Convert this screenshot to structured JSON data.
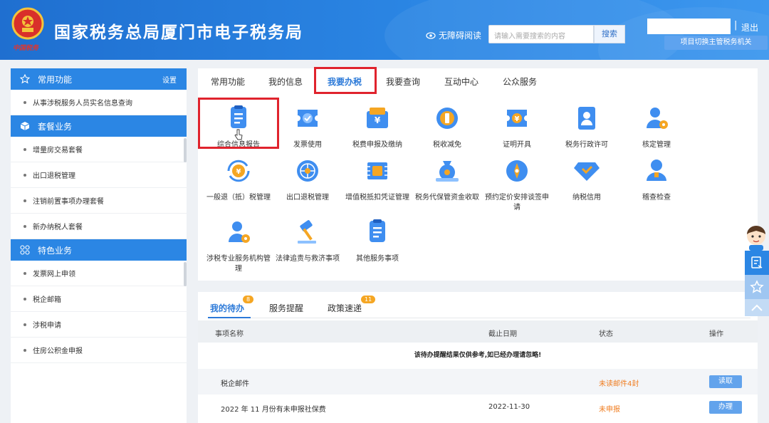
{
  "header": {
    "title": "国家税务总局厦门市电子税务局",
    "emblem_caption": "中国税务",
    "accessibility_label": "无障碍阅读",
    "search_placeholder": "请输入需要搜索的内容",
    "search_button": "搜索",
    "logout": "退出",
    "divider": "|",
    "switch_button": "项目切换主管税务机关"
  },
  "sidebar": {
    "sections": [
      {
        "title": "常用功能",
        "action": "设置",
        "icon": "star-icon",
        "items": [
          "从事涉税服务人员实名信息查询"
        ]
      },
      {
        "title": "套餐业务",
        "icon": "cube-icon",
        "items": [
          "增量房交易套餐",
          "出口退税管理",
          "注销前置事项办理套餐",
          "新办纳税人套餐"
        ]
      },
      {
        "title": "特色业务",
        "icon": "grid-icon",
        "items": [
          "发票网上申领",
          "税企邮箱",
          "涉税申请",
          "住房公积金申报"
        ]
      }
    ]
  },
  "main": {
    "tabs": [
      "常用功能",
      "我的信息",
      "我要办税",
      "我要查询",
      "互动中心",
      "公众服务"
    ],
    "active_tab": "我要办税",
    "services": [
      {
        "label": "综合信息报告",
        "icon": "document-icon"
      },
      {
        "label": "发票使用",
        "icon": "invoice-icon"
      },
      {
        "label": "税费申报及缴纳",
        "icon": "wallet-icon"
      },
      {
        "label": "税收减免",
        "icon": "coin-icon"
      },
      {
        "label": "证明开具",
        "icon": "certificate-icon"
      },
      {
        "label": "税务行政许可",
        "icon": "id-badge-icon"
      },
      {
        "label": "核定管理",
        "icon": "user-gear-icon"
      },
      {
        "label": "一般退（抵）税管理",
        "icon": "refund-icon"
      },
      {
        "label": "出口退税管理",
        "icon": "globe-icon"
      },
      {
        "label": "增值税抵扣凭证管理",
        "icon": "receipt-icon"
      },
      {
        "label": "税务代保管资金收取",
        "icon": "money-bag-icon"
      },
      {
        "label": "预约定价安排谈签申请",
        "icon": "compass-icon"
      },
      {
        "label": "纳税信用",
        "icon": "diamond-icon"
      },
      {
        "label": "稽查检查",
        "icon": "inspector-icon"
      },
      {
        "label": "涉税专业服务机构管理",
        "icon": "user-settings-icon"
      },
      {
        "label": "法律追责与救济事项",
        "icon": "gavel-icon"
      },
      {
        "label": "其他服务事项",
        "icon": "list-doc-icon"
      }
    ]
  },
  "todo": {
    "tabs": [
      {
        "label": "我的待办",
        "badge": "8"
      },
      {
        "label": "服务提醒",
        "badge": ""
      },
      {
        "label": "政策速递",
        "badge": "11"
      }
    ],
    "columns": [
      "事项名称",
      "截止日期",
      "状态",
      "操作"
    ],
    "notice": "该待办提醒结果仅供参考,如已经办理请忽略!",
    "rows": [
      {
        "name": "税企邮件",
        "date": "",
        "status": "未读邮件4封",
        "action": "读取"
      },
      {
        "name": "2022 年 11 月份有未申报社保费",
        "date": "2022-11-30",
        "status": "未申报",
        "action": "办理"
      }
    ]
  },
  "colors": {
    "primary": "#2b86e4",
    "highlight": "#e0232d",
    "warning": "#f07d20",
    "badge": "#f5a623"
  }
}
